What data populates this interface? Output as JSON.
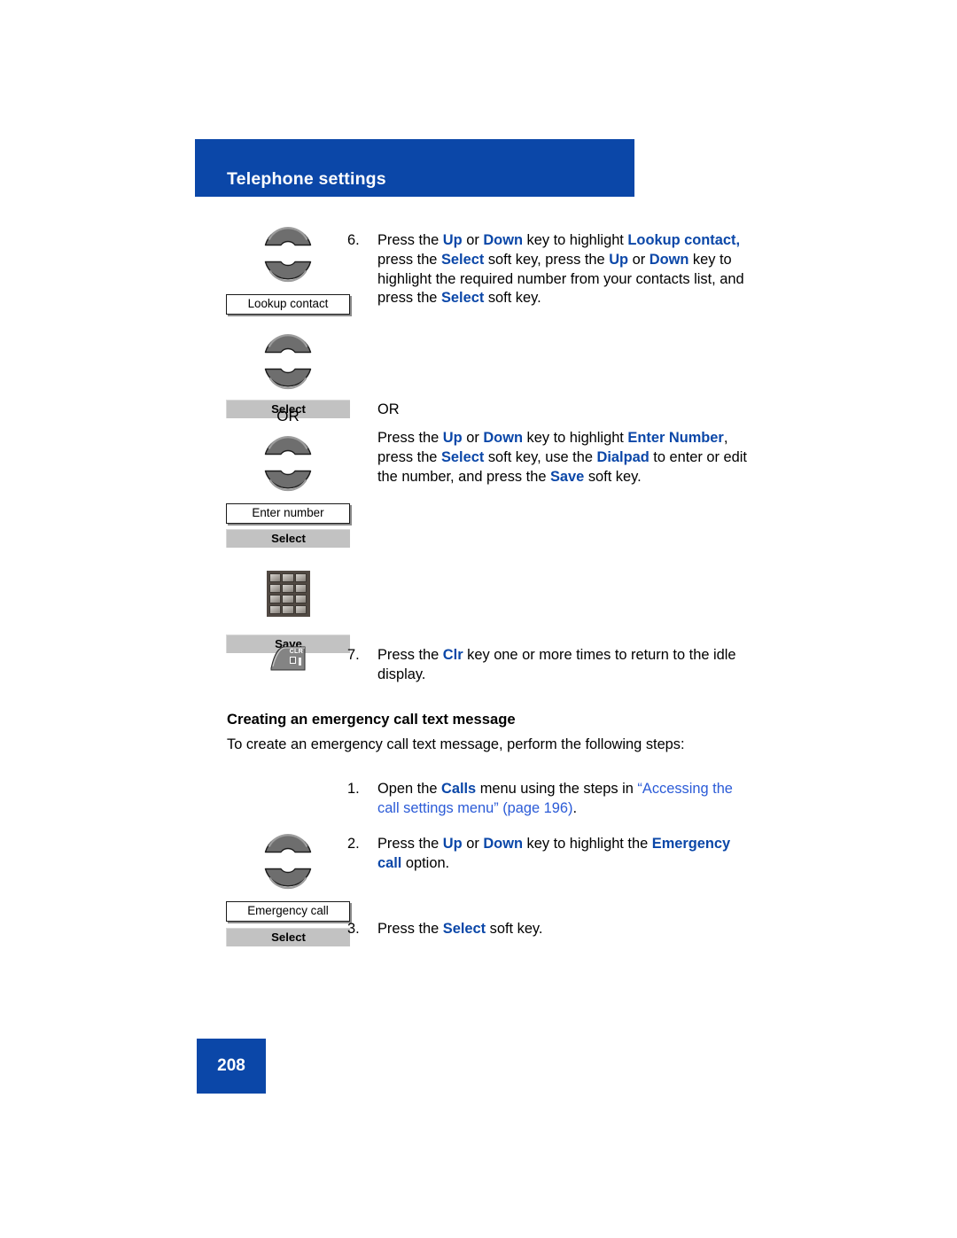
{
  "header": {
    "title": "Telephone settings"
  },
  "steps": {
    "step6": {
      "num": "6.",
      "seg1": "Press the ",
      "k1": "Up",
      "seg2": " or ",
      "k2": "Down",
      "seg3": " key to highlight ",
      "k3": "Lookup contact,",
      "seg4": " press the ",
      "k4": "Select",
      "seg5": " soft key, press the ",
      "k5": "Up",
      "seg6": " or ",
      "k6": "Down",
      "seg7": " key to highlight the required number from your contacts list, and press the ",
      "k7": "Select",
      "seg8": " soft key."
    },
    "or_text": "OR",
    "alt": {
      "seg1": "Press the ",
      "k1": "Up",
      "seg2": " or ",
      "k2": "Down",
      "seg3": " key to highlight ",
      "k3": "Enter Number",
      "seg4": ", press the ",
      "k4": "Select",
      "seg5": " soft key, use the ",
      "k5": "Dialpad",
      "seg6": " to enter or edit the number, and press the ",
      "k6": "Save",
      "seg7": " soft key."
    },
    "step7": {
      "num": "7.",
      "seg1": "Press the ",
      "k1": "Clr",
      "seg2": " key one or more times to return to the idle display."
    }
  },
  "section": {
    "heading": "Creating an emergency call text message",
    "intro": "To create an emergency call text message, perform the following steps:",
    "step1": {
      "num": "1.",
      "seg1": "Open the ",
      "k1": "Calls",
      "seg2": " menu using the steps in ",
      "xref": "“Accessing the call settings menu” (page 196)",
      "seg3": "."
    },
    "step2": {
      "num": "2.",
      "seg1": "Press the ",
      "k1": "Up",
      "seg2": " or ",
      "k2": "Down",
      "seg3": " key to highlight the ",
      "k3": "Emergency call",
      "seg4": " option."
    },
    "step3": {
      "num": "3.",
      "seg1": "Press the ",
      "k1": "Select",
      "seg2": " soft key."
    }
  },
  "icons": {
    "or_label": "OR",
    "lookup_contact_label": "Lookup contact",
    "select_softkey_1": "Select",
    "enter_number_label": "Enter number",
    "select_softkey_2": "Select",
    "save_softkey": "Save",
    "clr_key_label": "CLR",
    "emergency_call_label": "Emergency call",
    "select_softkey_3": "Select"
  },
  "footer": {
    "page_number": "208"
  },
  "colors": {
    "brand_blue": "#0B47A8",
    "xref_blue": "#2B5BD7",
    "softkey_gray": "#c2c2c2",
    "navkey_gray": "#6e6e6e"
  }
}
